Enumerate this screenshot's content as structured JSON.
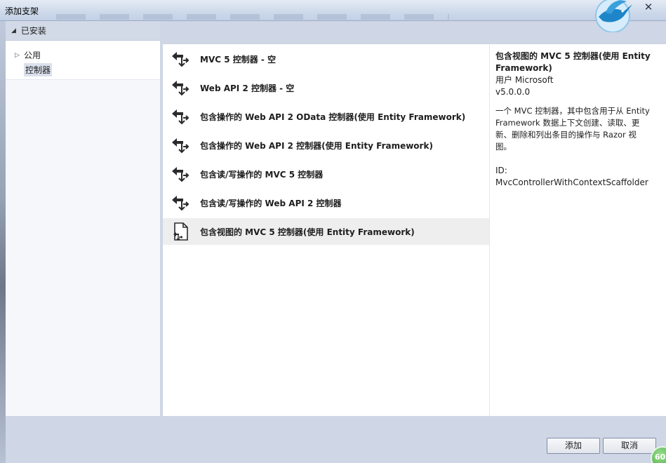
{
  "window": {
    "title": "添加支架",
    "close_glyph": "✕",
    "status_badge": "60"
  },
  "tree": {
    "header": "已安装",
    "items": [
      {
        "label": "公用",
        "expanded": false
      },
      {
        "label": "控制器",
        "selected": true
      }
    ]
  },
  "templates": [
    {
      "label": "MVC 5 控制器 - 空",
      "icon": "controller-icon"
    },
    {
      "label": "Web API 2 控制器 - 空",
      "icon": "controller-icon"
    },
    {
      "label": "包含操作的 Web API 2 OData 控制器(使用 Entity Framework)",
      "icon": "controller-icon"
    },
    {
      "label": "包含操作的 Web API 2 控制器(使用 Entity Framework)",
      "icon": "controller-icon"
    },
    {
      "label": "包含读/写操作的 MVC 5 控制器",
      "icon": "controller-icon"
    },
    {
      "label": "包含读/写操作的 Web API 2 控制器",
      "icon": "controller-icon"
    },
    {
      "label": "包含视图的 MVC 5 控制器(使用 Entity Framework)",
      "icon": "view-controller-icon",
      "selected": true
    }
  ],
  "details": {
    "title_line1": "包含视图的 MVC 5 控制器(使用 Entity",
    "title_line2": "Framework)",
    "author": "用户 Microsoft",
    "version": "v5.0.0.0",
    "description_lines": [
      "一个 MVC 控制器，其中包含用于从 Entity",
      "Framework 数据上下文创建、读取、更",
      "新、删除和列出条目的操作与 Razor 视",
      "图。"
    ],
    "id": "ID: MvcControllerWithContextScaffolder"
  },
  "buttons": {
    "add": "添加",
    "cancel": "取消"
  },
  "colors": {
    "selected_row": "#eeeeef",
    "frame": "#cfd6e5"
  }
}
